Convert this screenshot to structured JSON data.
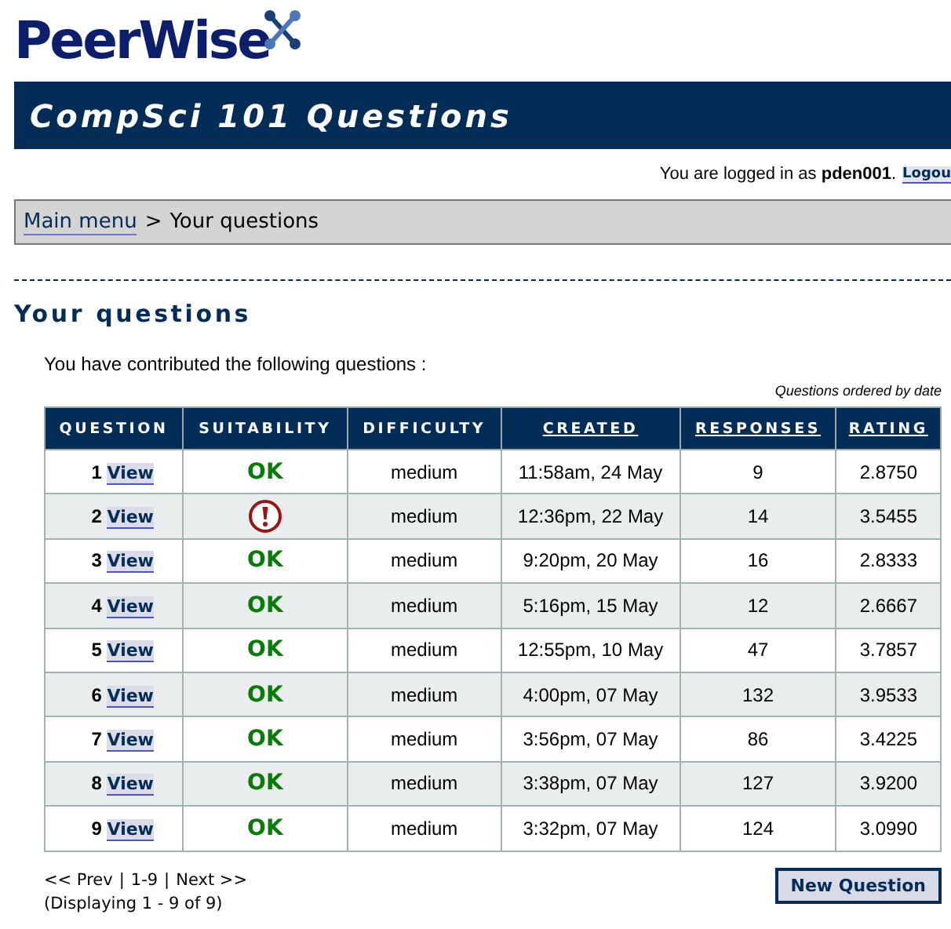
{
  "logo": {
    "text": "PeerWise"
  },
  "banner": {
    "title": "CompSci 101 Questions"
  },
  "login": {
    "prefix": "You are logged in as",
    "user": "pden001",
    "suffix": ".",
    "logout": "Logou"
  },
  "breadcrumb": {
    "link": "Main menu",
    "separator": ">",
    "current": "Your questions"
  },
  "heading": "Your questions",
  "intro": "You have contributed the following questions :",
  "order_note": "Questions ordered by date",
  "table": {
    "columns": [
      {
        "label": "QUESTION",
        "sortable": false
      },
      {
        "label": "SUITABILITY",
        "sortable": false
      },
      {
        "label": "DIFFICULTY",
        "sortable": false
      },
      {
        "label": "CREATED",
        "sortable": true
      },
      {
        "label": "RESPONSES",
        "sortable": true
      },
      {
        "label": "RATING",
        "sortable": true
      }
    ],
    "rows": [
      {
        "number": "1",
        "link": "View",
        "suitability": {
          "kind": "ok",
          "text": "OK"
        },
        "difficulty": "medium",
        "created": "11:58am, 24 May",
        "responses": "9",
        "rating": "2.8750"
      },
      {
        "number": "2",
        "link": "View",
        "suitability": {
          "kind": "flagged"
        },
        "difficulty": "medium",
        "created": "12:36pm, 22 May",
        "responses": "14",
        "rating": "3.5455"
      },
      {
        "number": "3",
        "link": "View",
        "suitability": {
          "kind": "ok",
          "text": "OK"
        },
        "difficulty": "medium",
        "created": "9:20pm, 20 May",
        "responses": "16",
        "rating": "2.8333"
      },
      {
        "number": "4",
        "link": "View",
        "suitability": {
          "kind": "ok",
          "text": "OK"
        },
        "difficulty": "medium",
        "created": "5:16pm, 15 May",
        "responses": "12",
        "rating": "2.6667"
      },
      {
        "number": "5",
        "link": "View",
        "suitability": {
          "kind": "ok",
          "text": "OK"
        },
        "difficulty": "medium",
        "created": "12:55pm, 10 May",
        "responses": "47",
        "rating": "3.7857"
      },
      {
        "number": "6",
        "link": "View",
        "suitability": {
          "kind": "ok",
          "text": "OK"
        },
        "difficulty": "medium",
        "created": "4:00pm, 07 May",
        "responses": "132",
        "rating": "3.9533"
      },
      {
        "number": "7",
        "link": "View",
        "suitability": {
          "kind": "ok",
          "text": "OK"
        },
        "difficulty": "medium",
        "created": "3:56pm, 07 May",
        "responses": "86",
        "rating": "3.4225"
      },
      {
        "number": "8",
        "link": "View",
        "suitability": {
          "kind": "ok",
          "text": "OK"
        },
        "difficulty": "medium",
        "created": "3:38pm, 07 May",
        "responses": "127",
        "rating": "3.9200"
      },
      {
        "number": "9",
        "link": "View",
        "suitability": {
          "kind": "ok",
          "text": "OK"
        },
        "difficulty": "medium",
        "created": "3:32pm, 07 May",
        "responses": "124",
        "rating": "3.0990"
      }
    ]
  },
  "pagination": {
    "prev": "<< Prev",
    "sep1": "|",
    "range": "1-9",
    "sep2": "|",
    "next": "Next >>",
    "summary": "(Displaying 1 - 9 of 9)"
  },
  "new_button": "New Question"
}
